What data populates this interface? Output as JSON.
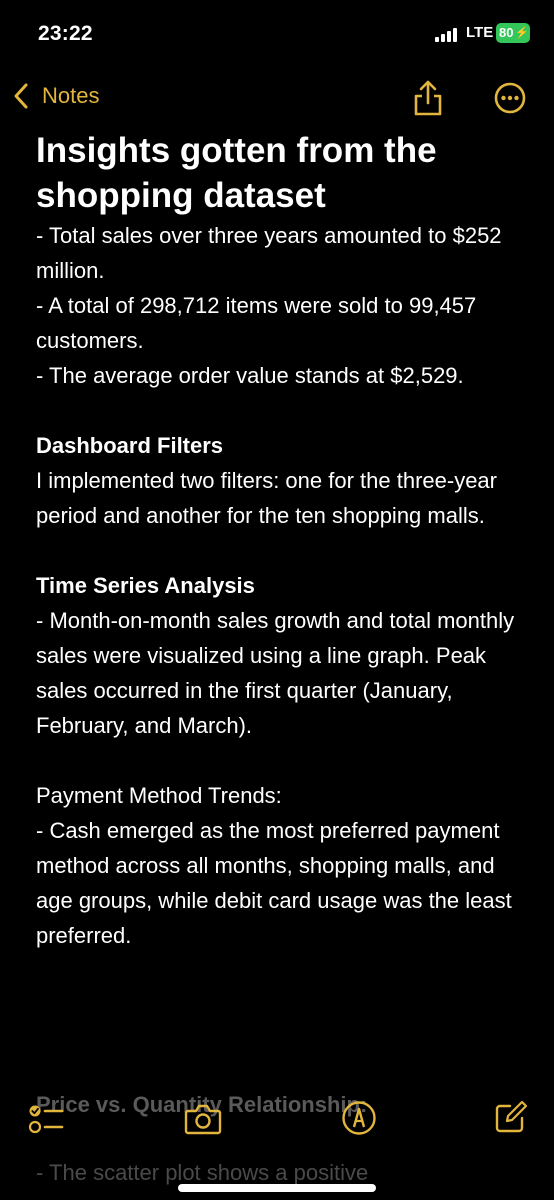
{
  "status_bar": {
    "time": "23:22",
    "network": "LTE",
    "battery": "80"
  },
  "nav": {
    "back_label": "Notes",
    "icons": {
      "back": "chevron-left-icon",
      "share": "share-icon",
      "more": "ellipsis-circle-icon"
    }
  },
  "note": {
    "title": "Insights gotten from the shopping dataset",
    "intro": "- Total sales over three years amounted to $252 million.\n- A total of 298,712 items were sold to 99,457 customers.\n- The average order value stands at $2,529.",
    "sections": [
      {
        "heading": "Dashboard Filters",
        "body": "I implemented two filters: one for the three-year period and another for the ten shopping malls."
      },
      {
        "heading": "Time Series Analysis",
        "body": "- Month-on-month sales growth and total monthly sales were visualized using a line graph. Peak sales occurred in the first quarter (January, February, and March)."
      },
      {
        "heading": "Payment Method Trends:",
        "body": "- Cash emerged as the most preferred payment method across all months, shopping malls, and age groups, while debit card usage was the least preferred."
      }
    ],
    "faded_heading": "Price vs. Quantity Relationship:",
    "faded_line": "- The scatter plot shows a positive"
  },
  "toolbar": {
    "icons": [
      "checklist-icon",
      "camera-icon",
      "markup-icon",
      "compose-icon"
    ]
  },
  "colors": {
    "accent": "#e2b53c",
    "background": "#000000",
    "text": "#ffffff",
    "battery": "#33c759"
  }
}
